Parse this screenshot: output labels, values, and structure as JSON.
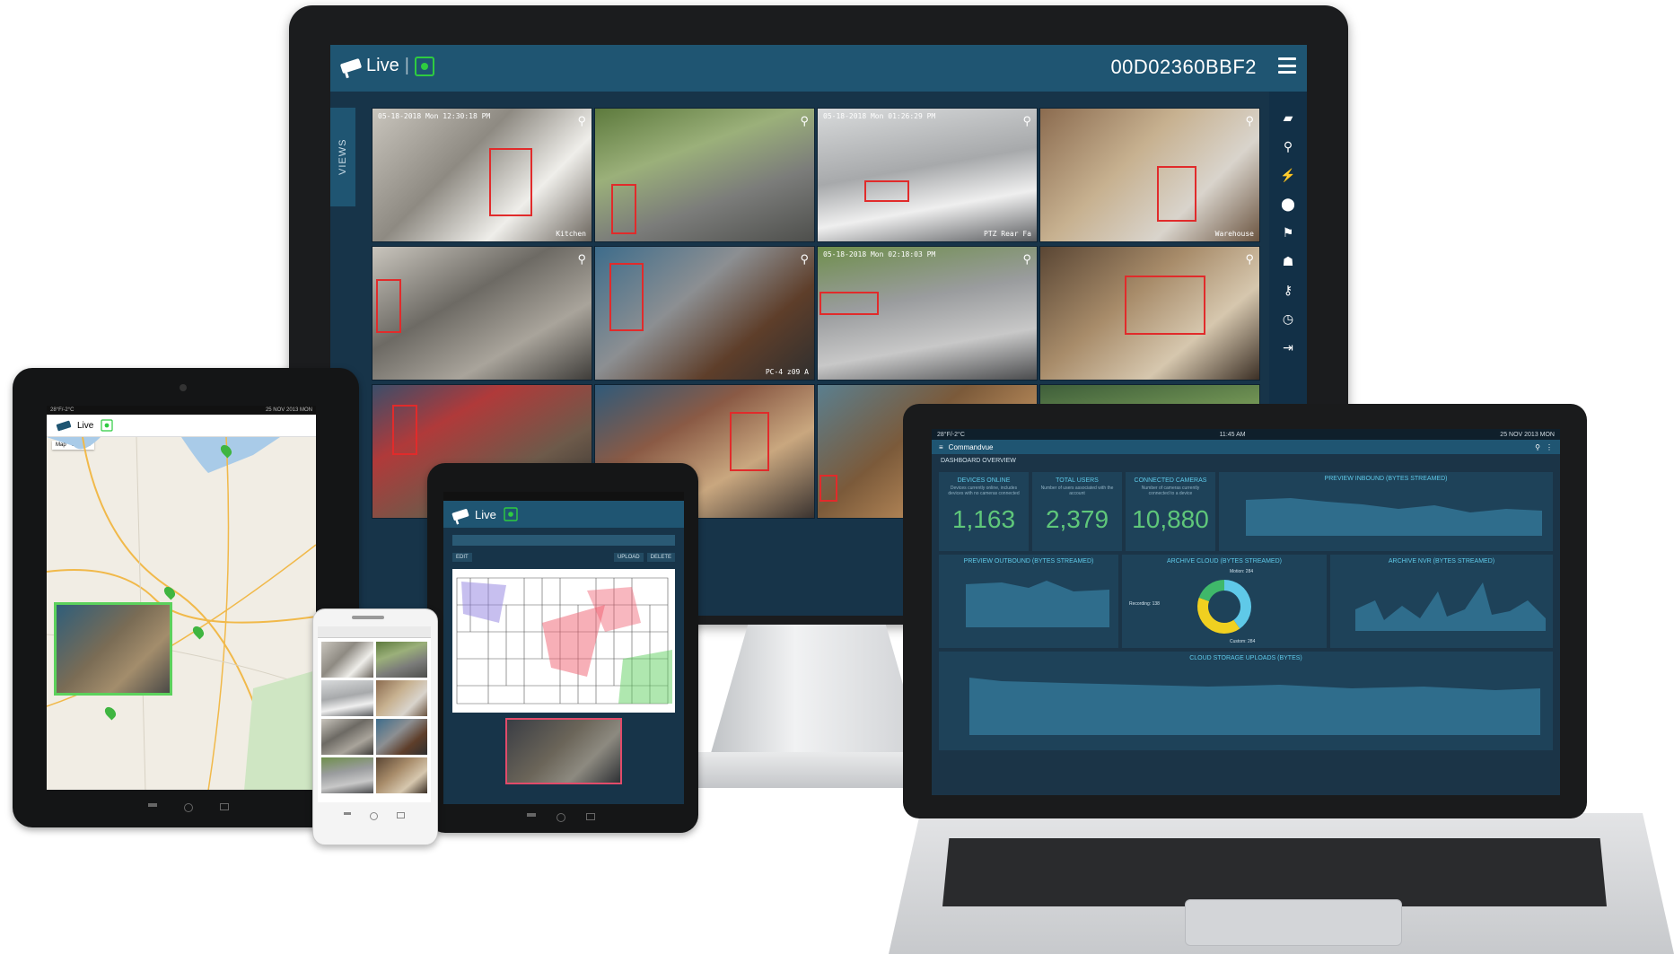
{
  "monitor": {
    "app_name": "Live",
    "separator": "|",
    "device_id": "00D02360BBF2",
    "views_tab": "VIEWS",
    "rail_icons": [
      "camera-icon",
      "search-icon",
      "lightning-icon",
      "map-pin-icon",
      "flag-icon",
      "user-icon",
      "key-icon",
      "clock-icon",
      "exit-icon"
    ],
    "tiles": [
      {
        "ts": "05-18-2018 Mon 12:30:18 PM",
        "label": "Kitchen"
      },
      {
        "ts": "",
        "label": ""
      },
      {
        "ts": "05-18-2018 Mon 01:26:29 PM",
        "label": "PTZ Rear Fa"
      },
      {
        "ts": "",
        "label": "Warehouse"
      },
      {
        "ts": "",
        "label": ""
      },
      {
        "ts": "",
        "label": "PC-4 z09 A"
      },
      {
        "ts": "05-18-2018 Mon 02:18:03 PM",
        "label": ""
      },
      {
        "ts": "",
        "label": ""
      },
      {
        "ts": "",
        "label": ""
      },
      {
        "ts": "",
        "label": ""
      },
      {
        "ts": "",
        "label": ""
      },
      {
        "ts": "",
        "label": ""
      }
    ]
  },
  "tablet_left": {
    "status_left": "28°F/-2°C",
    "status_right": "25 NOV 2013 MON",
    "app_name": "Live",
    "map_tab_1": "Map",
    "map_tab_2": "Satellite"
  },
  "tablet_middle": {
    "app_name": "Live",
    "edit_label": "EDIT",
    "upload_label": "UPLOAD",
    "delete_label": "DELETE"
  },
  "laptop": {
    "status_left": "28°F/-2°C",
    "status_time": "11:45 AM",
    "status_right": "25 NOV 2013 MON",
    "app_title": "Commandvue",
    "section_title": "DASHBOARD OVERVIEW",
    "kpis": [
      {
        "title": "DEVICES ONLINE",
        "sub": "Devices currently online, includes devices with no cameras connected",
        "value": "1,163"
      },
      {
        "title": "TOTAL USERS",
        "sub": "Number of users associated with the account",
        "value": "2,379"
      },
      {
        "title": "CONNECTED CAMERAS",
        "sub": "Number of cameras currently connected to a device",
        "value": "10,880"
      }
    ],
    "charts": {
      "inbound": "PREVIEW INBOUND (BYTES STREAMED)",
      "outbound": "PREVIEW OUTBOUND (BYTES STREAMED)",
      "archive_cloud": "ARCHIVE CLOUD (BYTES STREAMED)",
      "archive_nvr": "ARCHIVE NVR (BYTES STREAMED)",
      "cloud_uploads": "CLOUD STORAGE UPLOADS (BYTES)"
    },
    "donut": {
      "legend_top": "Motion: 284",
      "legend_left": "Recording: 138",
      "legend_bottom": "Custom: 284",
      "segments": [
        {
          "name": "Motion",
          "value": 284,
          "color": "#5fc9e8"
        },
        {
          "name": "Custom",
          "value": 284,
          "color": "#f0d020"
        },
        {
          "name": "Recording",
          "value": 138,
          "color": "#3fb86a"
        }
      ]
    },
    "legend_label": "bytes"
  },
  "colors": {
    "accent_blue": "#1f5572",
    "screen_bg": "#173449",
    "bbox_red": "#e12b2b",
    "kpi_green": "#5fc77a",
    "title_cyan": "#5fc9e8"
  }
}
